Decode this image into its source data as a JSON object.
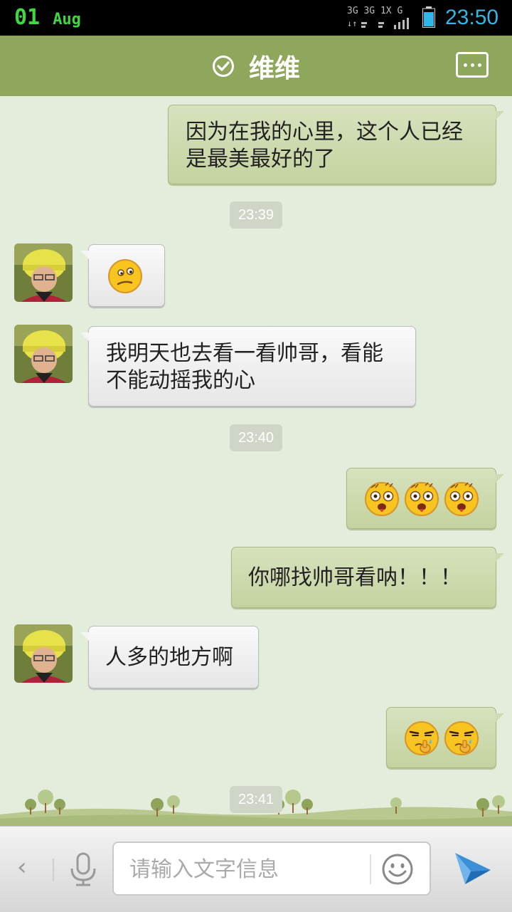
{
  "status_bar": {
    "date_day": "01",
    "date_month": "Aug",
    "network_top": "3G 3G 1X G",
    "time": "23:50"
  },
  "header": {
    "contact_name": "维维"
  },
  "messages": [
    {
      "direction": "out",
      "text": "因为在我的心里，这个人已经是最美最好的了"
    },
    {
      "timestamp": "23:39"
    },
    {
      "direction": "in",
      "emoji": "thinking-face-emoji"
    },
    {
      "direction": "in",
      "text": "我明天也去看一看帅哥，看能不能动摇我的心"
    },
    {
      "timestamp": "23:40"
    },
    {
      "direction": "out",
      "emoji": "drooling-face-emoji",
      "count": 3
    },
    {
      "direction": "out",
      "text": "你哪找帅哥看呐！！！"
    },
    {
      "direction": "in",
      "text": "人多的地方啊"
    },
    {
      "direction": "out",
      "emoji": "nose-picking-face-emoji",
      "count": 2
    },
    {
      "timestamp": "23:41"
    }
  ],
  "input_bar": {
    "placeholder": "请输入文字信息",
    "value": ""
  },
  "colors": {
    "header": "#8fa75c",
    "background": "#e4ecdc",
    "outgoing_bubble": "#c9d7a8",
    "incoming_bubble": "#f0f0f0",
    "clock": "#33b5e5",
    "date": "#3fd93f"
  }
}
